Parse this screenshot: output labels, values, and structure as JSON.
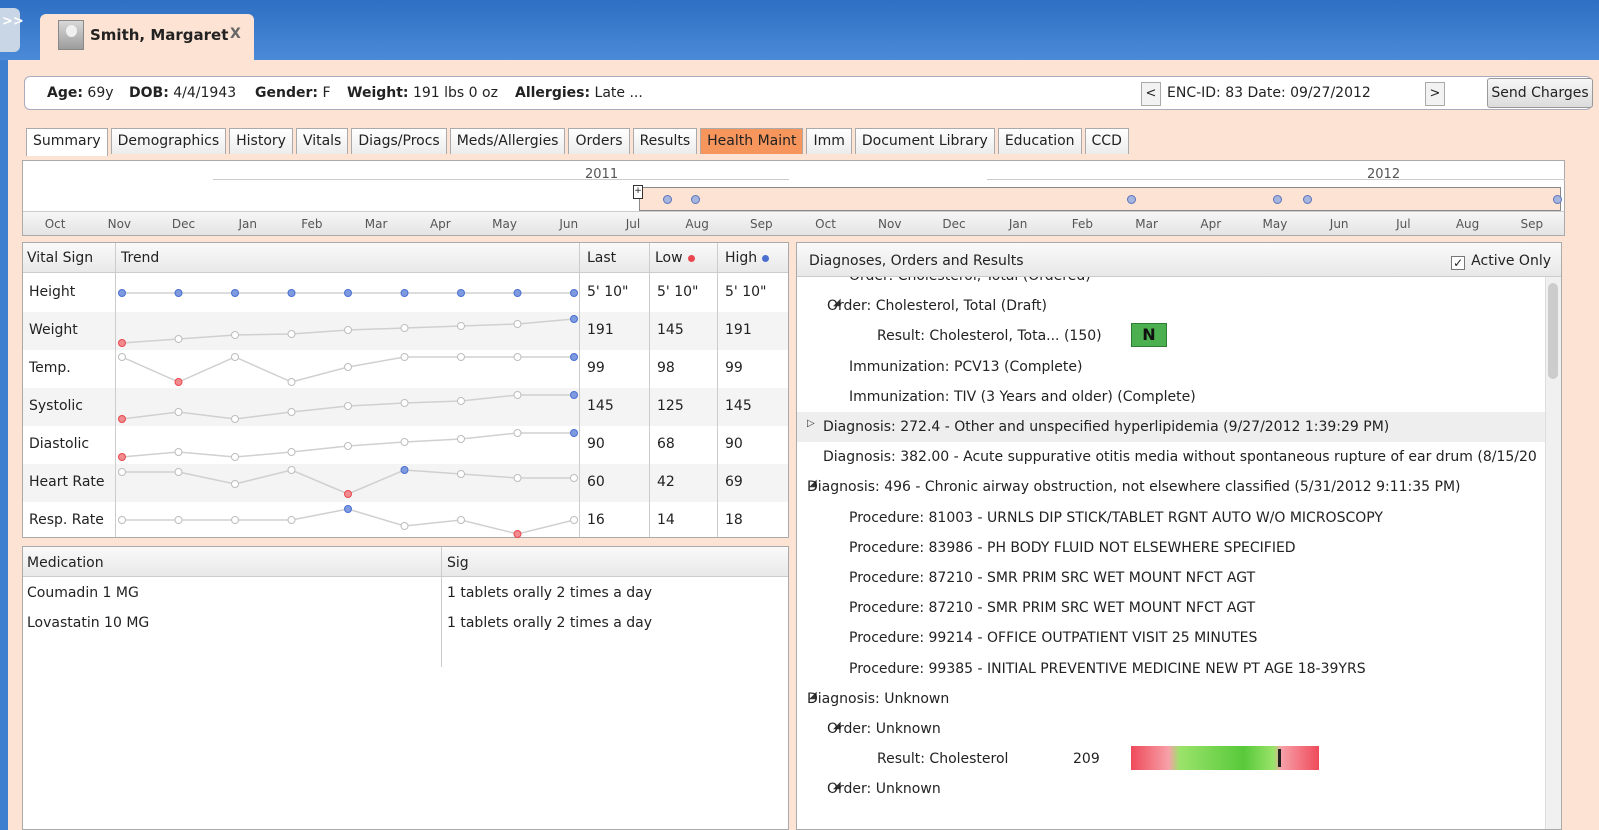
{
  "patient_tab": {
    "name": "Smith, Margaret",
    "close": "X"
  },
  "expand_glyph": ">>",
  "infobar": {
    "age_label": "Age:",
    "age": "69y",
    "dob_label": "DOB:",
    "dob": "4/4/1943",
    "gender_label": "Gender:",
    "gender": "F",
    "weight_label": "Weight:",
    "weight": "191 lbs 0 oz",
    "allergies_label": "Allergies:",
    "allergies": "Late ...",
    "prev": "<",
    "next": ">",
    "enc": "ENC-ID: 83  Date: 09/27/2012",
    "send_charges": "Send Charges"
  },
  "tabs": [
    "Summary",
    "Demographics",
    "History",
    "Vitals",
    "Diags/Procs",
    "Meds/Allergies",
    "Orders",
    "Results",
    "Health Maint",
    "Imm",
    "Document Library",
    "Education",
    "CCD"
  ],
  "active_tab": "Summary",
  "highlighted_tab": "Health Maint",
  "timeline": {
    "years": [
      "2011",
      "2012"
    ],
    "months": [
      "Oct",
      "Nov",
      "Dec",
      "Jan",
      "Feb",
      "Mar",
      "Apr",
      "May",
      "Jun",
      "Jul",
      "Aug",
      "Sep",
      "Oct",
      "Nov",
      "Dec",
      "Jan",
      "Feb",
      "Mar",
      "Apr",
      "May",
      "Jun",
      "Jul",
      "Aug",
      "Sep"
    ],
    "marker": "+"
  },
  "vitals": {
    "headers": {
      "sign": "Vital Sign",
      "trend": "Trend",
      "last": "Last",
      "low": "Low",
      "high": "High"
    },
    "low_color": "#e8474e",
    "high_color": "#4a6fd0",
    "rows": [
      {
        "name": "Height",
        "last": "5' 10\"",
        "low": "5' 10\"",
        "high": "5' 10\""
      },
      {
        "name": "Weight",
        "last": "191",
        "low": "145",
        "high": "191"
      },
      {
        "name": "Temp.",
        "last": "99",
        "low": "98",
        "high": "99"
      },
      {
        "name": "Systolic",
        "last": "145",
        "low": "125",
        "high": "145"
      },
      {
        "name": "Diastolic",
        "last": "90",
        "low": "68",
        "high": "90"
      },
      {
        "name": "Heart Rate",
        "last": "60",
        "low": "42",
        "high": "69"
      },
      {
        "name": "Resp. Rate",
        "last": "16",
        "low": "14",
        "high": "18"
      }
    ]
  },
  "medications": {
    "headers": {
      "medication": "Medication",
      "sig": "Sig"
    },
    "rows": [
      {
        "name": "Coumadin 1 MG",
        "sig": "1 tablets orally 2 times a day"
      },
      {
        "name": "Lovastatin 10 MG",
        "sig": "1 tablets orally 2 times a day"
      }
    ]
  },
  "dx": {
    "title": "Diagnoses, Orders and Results",
    "active_only": "Active Only",
    "check": "✓",
    "items": [
      {
        "arrow": "",
        "text": "Order: Cholesterol, Total (Ordered)"
      },
      {
        "arrow": "◢",
        "text": "Order: Cholesterol, Total (Draft)"
      },
      {
        "arrow": "",
        "text": "Result: Cholesterol, Tota... (150)"
      },
      {
        "arrow": "",
        "text": "Immunization: PCV13 (Complete)"
      },
      {
        "arrow": "",
        "text": "Immunization: TIV (3 Years and older) (Complete)"
      },
      {
        "arrow": "▷",
        "text": "Diagnosis: 272.4 - Other and unspecified hyperlipidemia (9/27/2012 1:39:29 PM)"
      },
      {
        "arrow": "",
        "text": "Diagnosis: 382.00 - Acute suppurative otitis media without spontaneous rupture of ear drum (8/15/20"
      },
      {
        "arrow": "◢",
        "text": "Diagnosis: 496 - Chronic airway obstruction, not elsewhere classified (5/31/2012 9:11:35 PM)"
      },
      {
        "arrow": "",
        "text": "Procedure: 81003 - URNLS DIP STICK/TABLET RGNT AUTO W/O MICROSCOPY"
      },
      {
        "arrow": "",
        "text": "Procedure: 83986 - PH BODY FLUID NOT ELSEWHERE SPECIFIED"
      },
      {
        "arrow": "",
        "text": "Procedure: 87210 - SMR PRIM SRC WET MOUNT NFCT AGT"
      },
      {
        "arrow": "",
        "text": "Procedure: 87210 - SMR PRIM SRC WET MOUNT NFCT AGT"
      },
      {
        "arrow": "",
        "text": "Procedure: 99214 - OFFICE OUTPATIENT VISIT 25 MINUTES"
      },
      {
        "arrow": "",
        "text": "Procedure: 99385 - INITIAL PREVENTIVE MEDICINE NEW PT AGE 18-39YRS"
      },
      {
        "arrow": "◢",
        "text": "Diagnosis: Unknown"
      },
      {
        "arrow": "◢",
        "text": "Order: Unknown"
      },
      {
        "arrow": "",
        "text": "Result: Cholesterol"
      },
      {
        "arrow": "◢",
        "text": "Order: Unknown"
      }
    ],
    "result_n": "N",
    "cholesterol_value": "209",
    "cholesterol_level": 0.78
  }
}
